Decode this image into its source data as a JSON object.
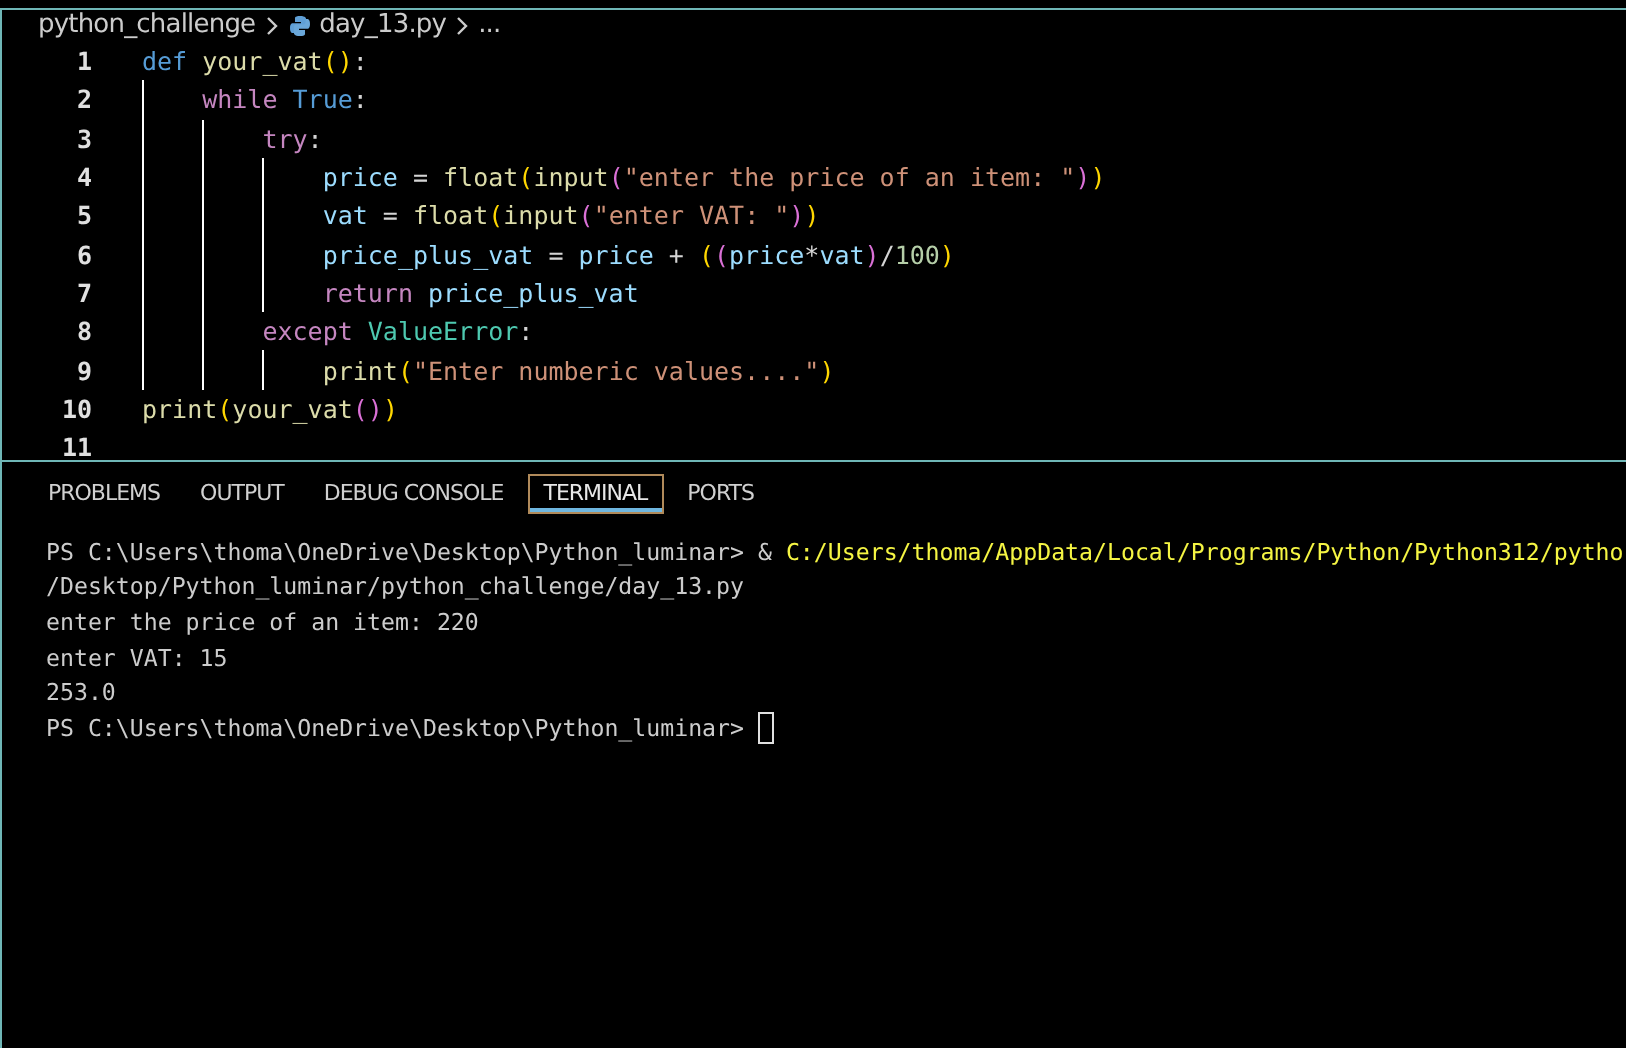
{
  "breadcrumb": {
    "folder": "python_challenge",
    "file": "day_13.py",
    "more": "..."
  },
  "editor": {
    "lines": [
      {
        "number": "1",
        "tokens": [
          {
            "kind": "keyword",
            "text": "def "
          },
          {
            "kind": "function",
            "text": "your_vat"
          },
          {
            "kind": "paren",
            "text": "()"
          },
          {
            "kind": "plain",
            "text": ":"
          }
        ],
        "children": [
          {
            "number": "2",
            "tokens": [
              {
                "kind": "control",
                "text": "while "
              },
              {
                "kind": "keyword",
                "text": "True"
              },
              {
                "kind": "plain",
                "text": ":"
              }
            ],
            "children": [
              {
                "number": "3",
                "tokens": [
                  {
                    "kind": "control",
                    "text": "try"
                  },
                  {
                    "kind": "plain",
                    "text": ":"
                  }
                ],
                "children": [
                  {
                    "number": "4",
                    "tokens": [
                      {
                        "kind": "variable",
                        "text": "price"
                      },
                      {
                        "kind": "plain",
                        "text": " = "
                      },
                      {
                        "kind": "function",
                        "text": "float"
                      },
                      {
                        "kind": "paren",
                        "text": "("
                      },
                      {
                        "kind": "function",
                        "text": "input"
                      },
                      {
                        "kind": "paren2",
                        "text": "("
                      },
                      {
                        "kind": "string",
                        "text": "\"enter the price of an item: \""
                      },
                      {
                        "kind": "paren2",
                        "text": ")"
                      },
                      {
                        "kind": "paren",
                        "text": ")"
                      }
                    ]
                  },
                  {
                    "number": "5",
                    "tokens": [
                      {
                        "kind": "variable",
                        "text": "vat"
                      },
                      {
                        "kind": "plain",
                        "text": " = "
                      },
                      {
                        "kind": "function",
                        "text": "float"
                      },
                      {
                        "kind": "paren",
                        "text": "("
                      },
                      {
                        "kind": "function",
                        "text": "input"
                      },
                      {
                        "kind": "paren2",
                        "text": "("
                      },
                      {
                        "kind": "string",
                        "text": "\"enter VAT: \""
                      },
                      {
                        "kind": "paren2",
                        "text": ")"
                      },
                      {
                        "kind": "paren",
                        "text": ")"
                      }
                    ]
                  },
                  {
                    "number": "6",
                    "tokens": [
                      {
                        "kind": "variable",
                        "text": "price_plus_vat"
                      },
                      {
                        "kind": "plain",
                        "text": " = "
                      },
                      {
                        "kind": "variable",
                        "text": "price"
                      },
                      {
                        "kind": "plain",
                        "text": " + "
                      },
                      {
                        "kind": "paren",
                        "text": "("
                      },
                      {
                        "kind": "paren2",
                        "text": "("
                      },
                      {
                        "kind": "variable",
                        "text": "price"
                      },
                      {
                        "kind": "plain",
                        "text": "*"
                      },
                      {
                        "kind": "variable",
                        "text": "vat"
                      },
                      {
                        "kind": "paren2",
                        "text": ")"
                      },
                      {
                        "kind": "plain",
                        "text": "/"
                      },
                      {
                        "kind": "number",
                        "text": "100"
                      },
                      {
                        "kind": "paren",
                        "text": ")"
                      }
                    ]
                  },
                  {
                    "number": "7",
                    "tokens": [
                      {
                        "kind": "control",
                        "text": "return "
                      },
                      {
                        "kind": "variable",
                        "text": "price_plus_vat"
                      }
                    ]
                  }
                ]
              },
              {
                "number": "8",
                "tokens": [
                  {
                    "kind": "control",
                    "text": "except "
                  },
                  {
                    "kind": "type",
                    "text": "ValueError"
                  },
                  {
                    "kind": "plain",
                    "text": ":"
                  }
                ],
                "children": [
                  {
                    "number": "9",
                    "tokens": [
                      {
                        "kind": "function",
                        "text": "print"
                      },
                      {
                        "kind": "paren",
                        "text": "("
                      },
                      {
                        "kind": "string",
                        "text": "\"Enter numberic values....\""
                      },
                      {
                        "kind": "paren",
                        "text": ")"
                      }
                    ]
                  }
                ]
              }
            ]
          }
        ]
      },
      {
        "number": "10",
        "tokens": [
          {
            "kind": "function",
            "text": "print"
          },
          {
            "kind": "paren",
            "text": "("
          },
          {
            "kind": "function",
            "text": "your_vat"
          },
          {
            "kind": "paren2",
            "text": "()"
          },
          {
            "kind": "paren",
            "text": ")"
          }
        ]
      },
      {
        "number": "11"
      }
    ]
  },
  "panel": {
    "tabs": [
      {
        "label": "PROBLEMS",
        "selected": false
      },
      {
        "label": "OUTPUT",
        "selected": false
      },
      {
        "label": "DEBUG CONSOLE",
        "selected": false
      },
      {
        "label": "TERMINAL",
        "selected": true
      },
      {
        "label": "PORTS",
        "selected": false
      }
    ],
    "terminal": [
      {
        "segments": [
          {
            "kind": "plain",
            "text": "PS C:\\Users\\thoma\\OneDrive\\Desktop\\Python_luminar> & "
          },
          {
            "kind": "path",
            "text": "C:/Users/thoma/AppData/Local/Programs/Python/Python312/pytho"
          }
        ]
      },
      {
        "segments": [
          {
            "kind": "plain",
            "text": "/Desktop/Python_luminar/python_challenge/day_13.py"
          }
        ]
      },
      {
        "segments": [
          {
            "kind": "plain",
            "text": "enter the price of an item: 220"
          }
        ]
      },
      {
        "segments": [
          {
            "kind": "plain",
            "text": "enter VAT: 15"
          }
        ]
      },
      {
        "segments": [
          {
            "kind": "plain",
            "text": "253.0"
          }
        ]
      },
      {
        "segments": [
          {
            "kind": "plain",
            "text": "PS C:\\Users\\thoma\\OneDrive\\Desktop\\Python_luminar> "
          }
        ],
        "cursor": true
      }
    ]
  }
}
